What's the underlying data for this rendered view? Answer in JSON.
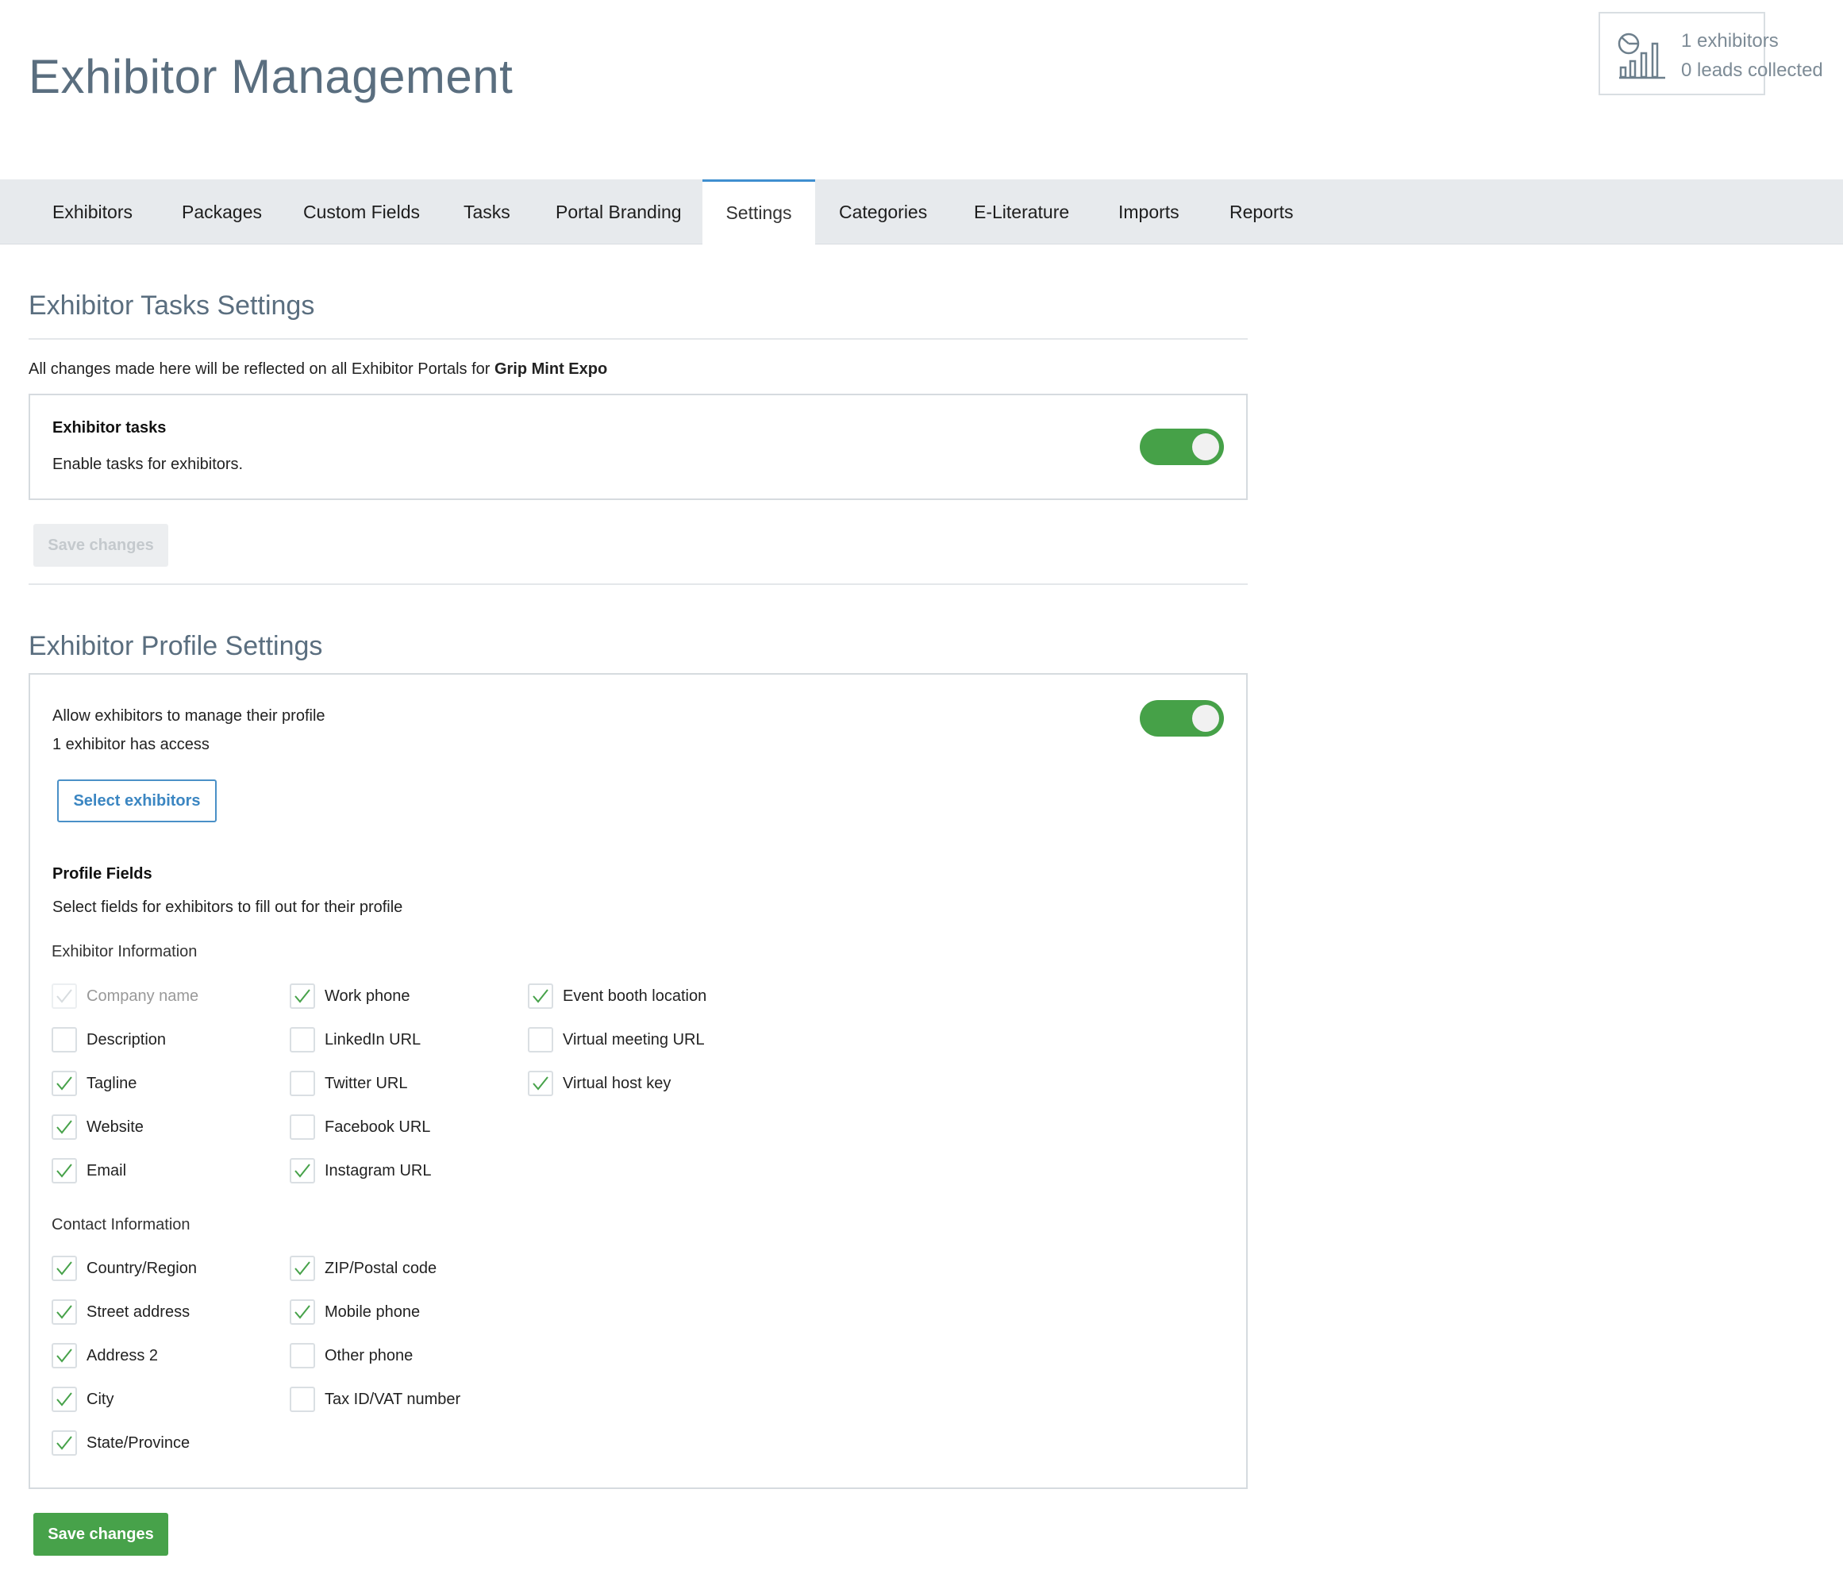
{
  "page": {
    "title": "Exhibitor Management"
  },
  "stats": {
    "exhibitors": "1 exhibitors",
    "leads": "0 leads collected"
  },
  "tabs": [
    {
      "label": "Exhibitors"
    },
    {
      "label": "Packages"
    },
    {
      "label": "Custom Fields"
    },
    {
      "label": "Tasks"
    },
    {
      "label": "Portal Branding"
    },
    {
      "label": "Settings",
      "active": true
    },
    {
      "label": "Categories"
    },
    {
      "label": "E-Literature"
    },
    {
      "label": "Imports"
    },
    {
      "label": "Reports"
    }
  ],
  "tasks_settings": {
    "title": "Exhibitor Tasks Settings",
    "note_prefix": "All changes made here will be reflected on all Exhibitor Portals for",
    "event_name": "Grip Mint Expo",
    "card_title": "Exhibitor tasks",
    "card_text": "Enable tasks for exhibitors.",
    "toggle_on": true,
    "save_label": "Save changes"
  },
  "profile_settings": {
    "title": "Exhibitor Profile Settings",
    "allow_text": "Allow exhibitors to manage their profile",
    "access_text": "1 exhibitor has access",
    "toggle_on": true,
    "select_button": "Select exhibitors",
    "fields_title": "Profile Fields",
    "fields_text": "Select fields for exhibitors to fill out for their profile",
    "exhibitor_info_label": "Exhibitor Information",
    "contact_info_label": "Contact Information",
    "save_label": "Save changes",
    "exhibitor_info": {
      "col1": [
        {
          "label": "Company name",
          "checked": true,
          "disabled": true
        },
        {
          "label": "Description",
          "checked": false
        },
        {
          "label": "Tagline",
          "checked": true
        },
        {
          "label": "Website",
          "checked": true
        },
        {
          "label": "Email",
          "checked": true
        }
      ],
      "col2": [
        {
          "label": "Work phone",
          "checked": true
        },
        {
          "label": "LinkedIn URL",
          "checked": false
        },
        {
          "label": "Twitter URL",
          "checked": false
        },
        {
          "label": "Facebook URL",
          "checked": false
        },
        {
          "label": "Instagram URL",
          "checked": true
        }
      ],
      "col3": [
        {
          "label": "Event booth location",
          "checked": true
        },
        {
          "label": "Virtual meeting URL",
          "checked": false
        },
        {
          "label": "Virtual host key",
          "checked": true
        }
      ]
    },
    "contact_info": {
      "col1": [
        {
          "label": "Country/Region",
          "checked": true
        },
        {
          "label": "Street address",
          "checked": true
        },
        {
          "label": "Address 2",
          "checked": true
        },
        {
          "label": "City",
          "checked": true
        },
        {
          "label": "State/Province",
          "checked": true
        }
      ],
      "col2": [
        {
          "label": "ZIP/Postal code",
          "checked": true
        },
        {
          "label": "Mobile phone",
          "checked": true
        },
        {
          "label": "Other phone",
          "checked": false
        },
        {
          "label": "Tax ID/VAT number",
          "checked": false
        }
      ]
    }
  },
  "colors": {
    "accent": "#46a148",
    "link": "#3b86c2",
    "tab_active_border": "#3f8fd0",
    "title": "#5a6e7f"
  }
}
